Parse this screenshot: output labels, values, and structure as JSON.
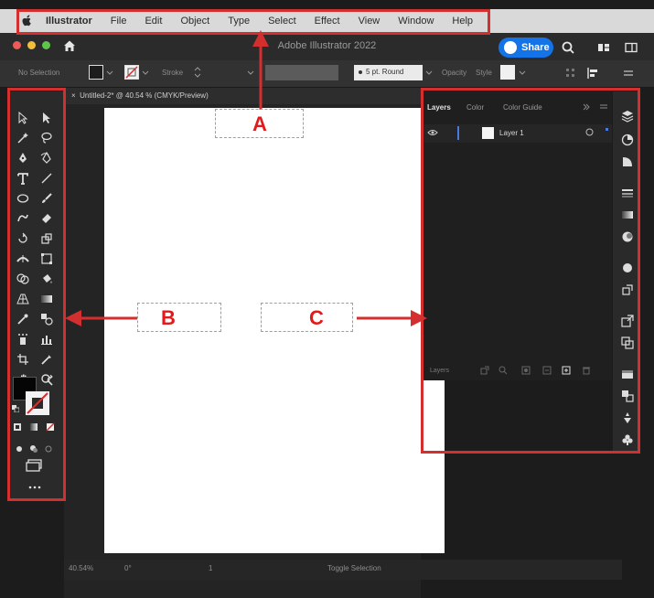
{
  "menubar": {
    "app_name": "Illustrator",
    "items": [
      "File",
      "Edit",
      "Object",
      "Type",
      "Select",
      "Effect",
      "View",
      "Window",
      "Help"
    ]
  },
  "window": {
    "title": "Adobe Illustrator 2022",
    "share_label": "Share"
  },
  "controlbar": {
    "selection": "No Selection",
    "stroke_label": "Stroke",
    "brush": "5 pt. Round",
    "opacity_label": "Opacity",
    "style_label": "Style"
  },
  "document": {
    "tab_title": "Untitled-2* @ 40.54 % (CMYK/Preview)",
    "zoom": "40.54%",
    "rotation": "0°",
    "artboard_number": "1",
    "status": "Toggle Selection"
  },
  "layers_panel": {
    "tabs": [
      "Layers",
      "Color",
      "Color Guide"
    ],
    "layer_name": "Layer 1",
    "footer_label": "Layers"
  },
  "callouts": [
    "A",
    "B",
    "C"
  ],
  "colors": {
    "callout_red": "#d32f2f",
    "share_blue": "#1473e6"
  }
}
